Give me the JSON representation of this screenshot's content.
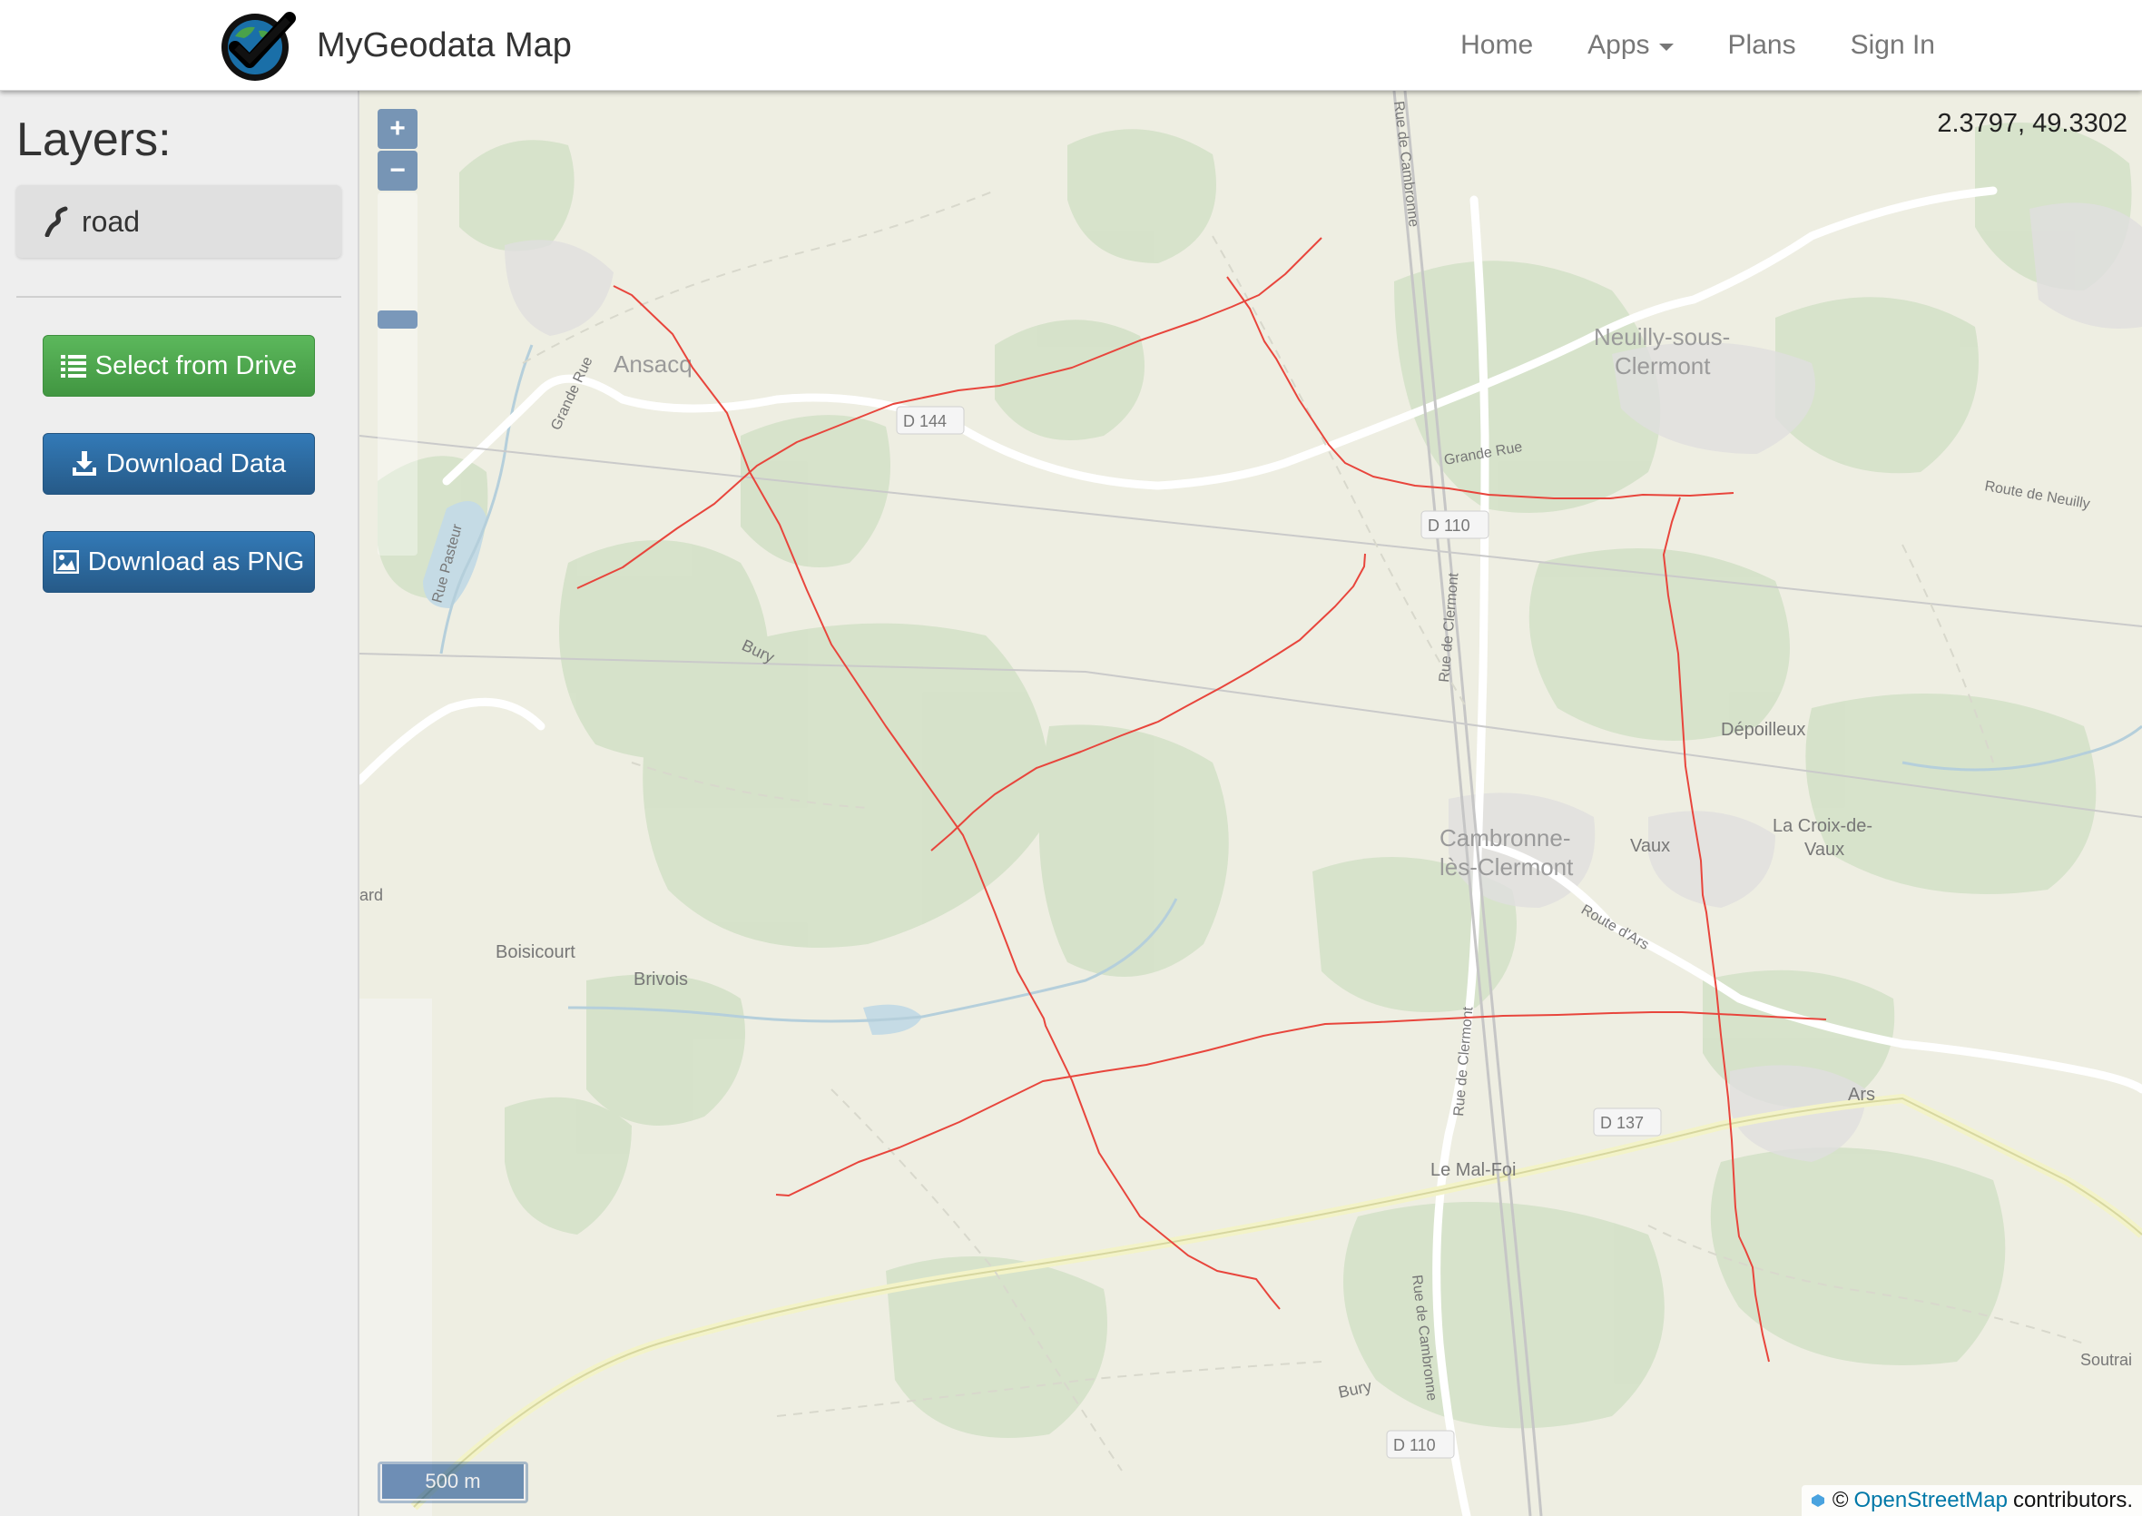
{
  "navbar": {
    "brand_title": "MyGeodata Map",
    "nav_items": [
      "Home",
      "Apps",
      "Plans",
      "Sign In"
    ]
  },
  "sidebar": {
    "layers_title": "Layers:",
    "layer_name": "road",
    "select_drive_label": "Select from Drive",
    "download_data_label": "Download Data",
    "download_png_label": "Download as PNG"
  },
  "map": {
    "zoom_in": "+",
    "zoom_out": "−",
    "coordinates": "2.3797, 49.3302",
    "scale_label": "500 m",
    "attribution_prefix": "©",
    "attribution_link": "OpenStreetMap",
    "attribution_suffix": "contributors.",
    "labels": {
      "ansacq": "Ansacq",
      "neuilly1": "Neuilly-sous-",
      "neuilly2": "Clermont",
      "cambronne1": "Cambronne-",
      "cambronne2": "lès-Clermont",
      "depoilleux": "Dépoilleux",
      "vaux": "Vaux",
      "croix1": "La Croix-de-",
      "croix2": "Vaux",
      "boisicourt": "Boisicourt",
      "brivois": "Brivois",
      "ars": "Ars",
      "lemalfoi": "Le Mal-Foi",
      "bury1": "Bury",
      "bury2": "Bury",
      "soutrai": "Soutrai",
      "ard": "ard",
      "d144": "D 144",
      "d110a": "D 110",
      "d110b": "D 110",
      "d137": "D 137",
      "grande_rue": "Grande Rue",
      "grande_rue2": "Grande Rue",
      "rue_cambronne1": "Rue de Cambronne",
      "rue_cambronne2": "Rue de Cambronne",
      "rue_clermont": "Rue de Clermont",
      "rue_clermont2": "Rue de Clermont",
      "rue_pasteur": "Rue Pasteur",
      "route_neuilly": "Route de Neuilly",
      "route_ars": "Route d'Ars"
    }
  },
  "colors": {
    "road_line": "#e8453c",
    "btn_green": "#4cae4c",
    "btn_blue": "#2e6da4"
  }
}
